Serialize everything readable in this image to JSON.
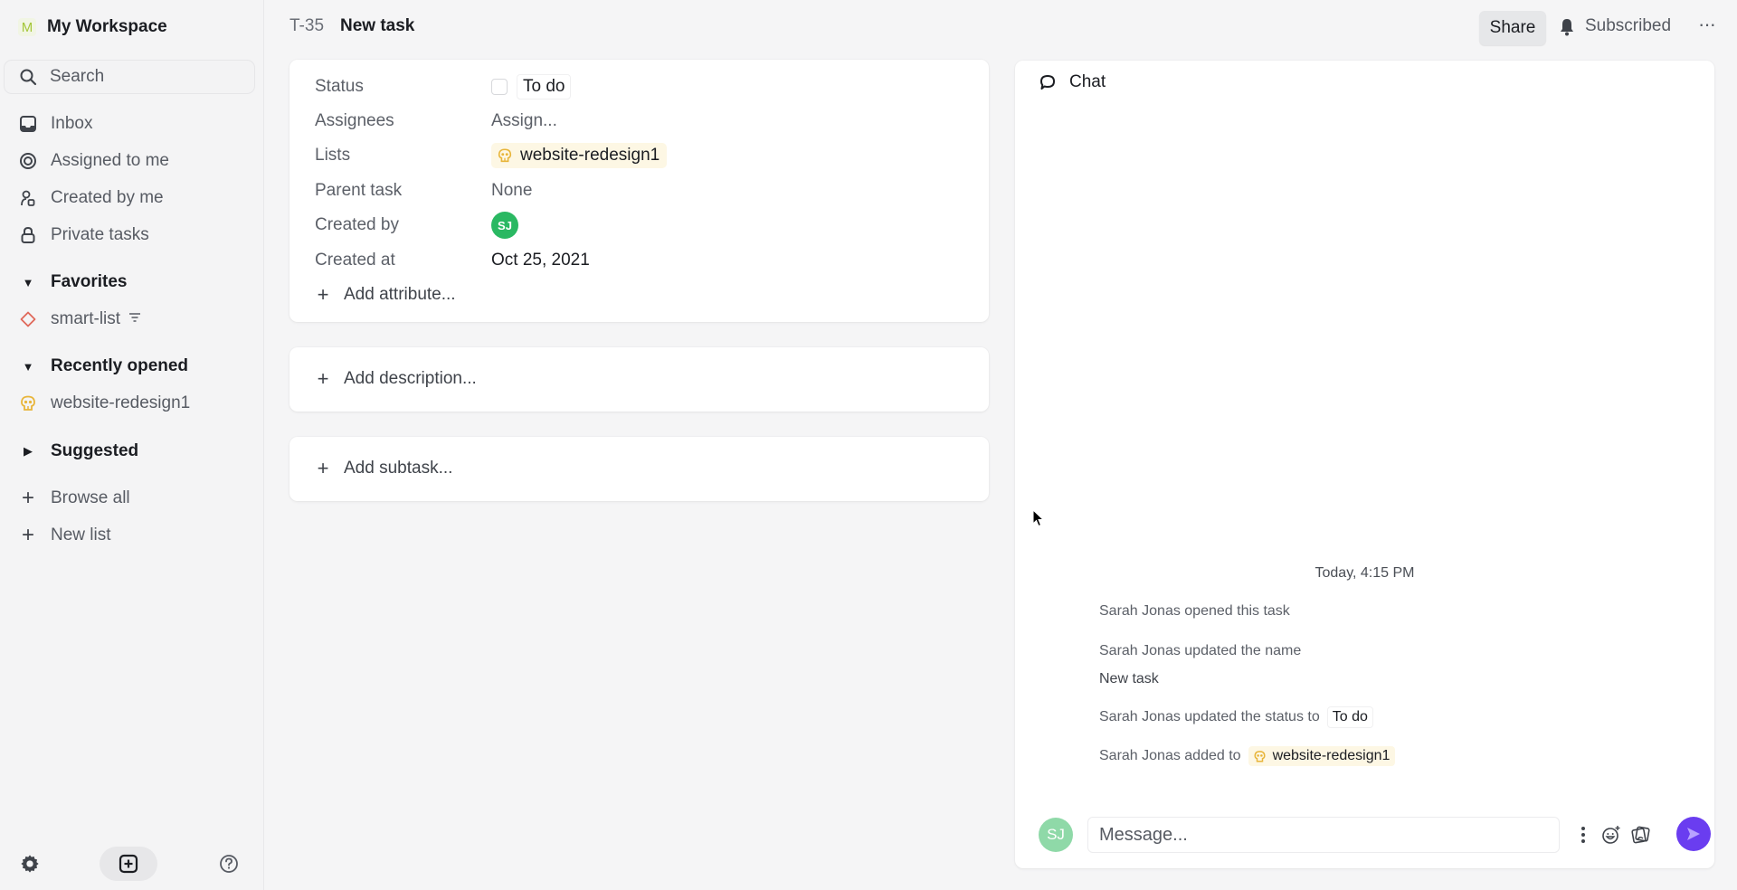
{
  "sidebar": {
    "workspace": {
      "initial": "M",
      "name": "My Workspace",
      "accent": "#a4c639"
    },
    "search_placeholder": "Search",
    "nav": [
      {
        "label": "Inbox",
        "icon": "inbox-icon"
      },
      {
        "label": "Assigned to me",
        "icon": "target-icon"
      },
      {
        "label": "Created by me",
        "icon": "user-created-icon"
      },
      {
        "label": "Private tasks",
        "icon": "lock-icon"
      }
    ],
    "sections": {
      "favorites": {
        "label": "Favorites",
        "expanded": true,
        "items": [
          {
            "label": "smart-list",
            "icon": "diamond-icon",
            "color": "#e0685a",
            "has_filter": true
          }
        ]
      },
      "recent": {
        "label": "Recently opened",
        "expanded": true,
        "items": [
          {
            "label": "website-redesign1",
            "icon": "skull-icon",
            "color": "#e8b53a"
          }
        ]
      },
      "suggested": {
        "label": "Suggested",
        "expanded": false
      }
    },
    "actions": [
      {
        "label": "Browse all"
      },
      {
        "label": "New list"
      }
    ],
    "bottom": {
      "settings": "settings-icon",
      "create": "add-task-icon",
      "help": "help-icon"
    }
  },
  "header": {
    "task_id": "T-35",
    "task_name": "New task",
    "share_label": "Share",
    "subscribed_label": "Subscribed",
    "more_label": "···"
  },
  "attributes": {
    "status": {
      "label": "Status",
      "value": "To do"
    },
    "assignees": {
      "label": "Assignees",
      "value": "Assign..."
    },
    "lists": {
      "label": "Lists",
      "value": "website-redesign1"
    },
    "parent": {
      "label": "Parent task",
      "value": "None"
    },
    "created_by": {
      "label": "Created by",
      "initials": "SJ",
      "color": "#2ab862"
    },
    "created_at": {
      "label": "Created at",
      "value": "Oct 25, 2021"
    },
    "add_attribute": "Add attribute..."
  },
  "description": {
    "add_label": "Add description..."
  },
  "subtasks": {
    "add_label": "Add subtask..."
  },
  "chat": {
    "title": "Chat",
    "date_divider": "Today, 4:15 PM",
    "activity": [
      {
        "text": "Sarah Jonas opened this task"
      },
      {
        "text": "Sarah Jonas updated the name",
        "detail": "New task"
      },
      {
        "text": "Sarah Jonas updated the status to",
        "chip": "To do"
      },
      {
        "text": "Sarah Jonas added to",
        "list_chip": "website-redesign1"
      }
    ],
    "composer": {
      "avatar_initials": "SJ",
      "placeholder": "Message...",
      "value": "",
      "send_color": "#6a3df0"
    }
  }
}
